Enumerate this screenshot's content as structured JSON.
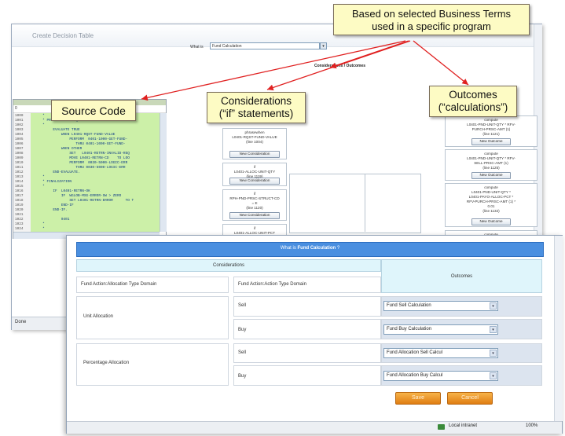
{
  "back_window": {
    "title": "Create Decision Table",
    "what_label": "What is",
    "what_value": "Fund Calculation",
    "considerations_outcomes_header": "Considerations / Outcomes",
    "status_text": "Done"
  },
  "code_panel": {
    "first_row": "0",
    "lines": [
      {
        "n": "1000",
        "t": "     *"
      },
      {
        "n": "1001",
        "t": "     * PROCESS THE REQUEST"
      },
      {
        "n": "1002",
        "t": "     *"
      },
      {
        "n": "1003",
        "t": "          EVALUATE TRUE"
      },
      {
        "n": "1004",
        "t": "              WHEN L0401-RQST-FUND-VALUE"
      },
      {
        "n": "1005",
        "t": "                  PERFORM  0401-1000-GET-FUND-"
      },
      {
        "n": "1006",
        "t": "                     THRU 0401-1000-GET-FUND-"
      },
      {
        "n": "1007",
        "t": "              WHEN OTHER"
      },
      {
        "n": "1008",
        "t": "                  SET   L0401-RETRN-INVALID-REQ"
      },
      {
        "n": "1009",
        "t": "                  MOVE L0401-RETRN-CD    TO LOO"
      },
      {
        "n": "1010",
        "t": "                  PERFORM  0030-5000-LOGIC-ERR"
      },
      {
        "n": "1011",
        "t": "                     THRU 0030-5000-LOGIC-ERR"
      },
      {
        "n": "1012",
        "t": "          END-EVALUATE."
      },
      {
        "n": "1013",
        "t": "     *"
      },
      {
        "n": "1014",
        "t": "     * FINALIZATION"
      },
      {
        "n": "1015",
        "t": "     *"
      },
      {
        "n": "1016",
        "t": "          IF  L0401-RETRN-OK"
      },
      {
        "n": "1017",
        "t": "              IF  WGLOB-MSG-ERROR-SW > ZERO"
      },
      {
        "n": "1018",
        "t": "                  SET L0401-RETRN-ERROR      TO T"
      },
      {
        "n": "1019",
        "t": "              END-IF"
      },
      {
        "n": "1020",
        "t": "          END-IF."
      },
      {
        "n": "1021",
        "t": ""
      },
      {
        "n": "1022",
        "t": "              0401"
      },
      {
        "n": "1023",
        "t": "     *"
      },
      {
        "n": "1024",
        "t": "     *"
      }
    ]
  },
  "considerations": [
    {
      "text": "phrasewhen\nL0401-RQST-FUND-VALUE\n(line 1004)",
      "button": "New Consideration"
    },
    {
      "text": "if\nL0401-ALLOC-UNIT-QTY\n(line 1119)",
      "button": "New Consideration"
    },
    {
      "text": "if\nRPH-PND-PRSC-STRUCT-CD\n= E\n(line 1120)",
      "button": "New Consideration"
    },
    {
      "text": "if\nL0401-ALLOC-UNIT-PCT",
      "button": ""
    }
  ],
  "outcomes": [
    {
      "text": "compute\nL0401-PND-UNIT-QTY * RFV-\nPURCH-PRSC-AMT (1)\n(line 1121)",
      "button": "New Outcome"
    },
    {
      "text": "compute\nL0401-PND-UNIT-QTY * RFV-\nSELL-PRSC-AMT (1)\n(line 1125)",
      "button": "New Outcome"
    },
    {
      "text": "compute\nL0401-PND-UNIT-QTY *\nL0401-PAYO-ALLOC-PCT *\nRFV-PURCH-PRSC-AMT (1) *\n0.01\n(line 1132)",
      "button": "New Outcome"
    },
    {
      "text": "compute",
      "button": ""
    }
  ],
  "front_window": {
    "header_prefix": "What is",
    "header_bold": "Fund Calculation",
    "header_suffix": "?",
    "considerations_label": "Considerations",
    "outcomes_label": "Outcomes",
    "col1_header": "Fund Action:Allocation Type Domain",
    "col2_header": "Fund Action:Action Type Domain",
    "groups": [
      {
        "label": "Unit Allocation",
        "rows": [
          {
            "action": "Sell",
            "outcome": "Fund Sell Calculation"
          },
          {
            "action": "Buy",
            "outcome": "Fund Buy Calculation"
          }
        ]
      },
      {
        "label": "Percentage Allocation",
        "rows": [
          {
            "action": "Sell",
            "outcome": "Fund Allocation Sell Calcul"
          },
          {
            "action": "Buy",
            "outcome": "Fund Allocation Buy Calcul"
          }
        ]
      }
    ],
    "save_label": "Save",
    "cancel_label": "Cancel",
    "status_zone": "Local intranet",
    "status_zoom": "100%"
  },
  "callouts": {
    "business_terms": "Based on selected Business Terms\nused in a specific program",
    "source_code": "Source Code",
    "considerations": "Considerations\n(“if” statements)",
    "outcomes": "Outcomes\n(“calculations”)"
  },
  "colors": {
    "code_highlight": "#ccf0a8",
    "header_blue": "#4a8fe0",
    "callout_fill": "#fdfbc4",
    "arrow_red": "#e02020",
    "button_orange": "#e98d22"
  }
}
